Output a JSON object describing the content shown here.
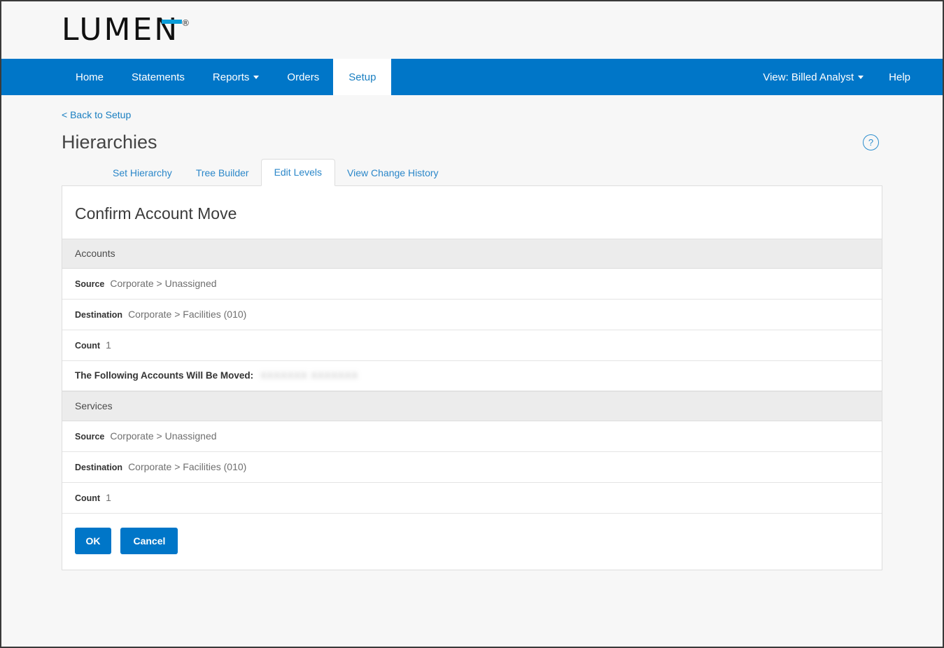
{
  "brand": {
    "logo_text": "LUMEN",
    "registered_mark": "®"
  },
  "nav": {
    "items": [
      {
        "label": "Home",
        "active": false,
        "caret": false
      },
      {
        "label": "Statements",
        "active": false,
        "caret": false
      },
      {
        "label": "Reports",
        "active": false,
        "caret": true
      },
      {
        "label": "Orders",
        "active": false,
        "caret": false
      },
      {
        "label": "Setup",
        "active": true,
        "caret": false
      }
    ],
    "view_selector": "View: Billed Analyst",
    "help": "Help"
  },
  "page": {
    "back_link": "< Back to Setup",
    "title": "Hierarchies",
    "help_icon": "?"
  },
  "tabs": [
    {
      "label": "Set Hierarchy",
      "active": false
    },
    {
      "label": "Tree Builder",
      "active": false
    },
    {
      "label": "Edit Levels",
      "active": true
    },
    {
      "label": "View Change History",
      "active": false
    }
  ],
  "card": {
    "title": "Confirm Account Move",
    "accounts": {
      "heading": "Accounts",
      "source_label": "Source",
      "source_value": "Corporate > Unassigned",
      "destination_label": "Destination",
      "destination_value": "Corporate > Facilities (010)",
      "count_label": "Count",
      "count_value": "1",
      "moved_label": "The Following Accounts Will Be Moved:",
      "moved_value": "XXXXXXX XXXXXXX"
    },
    "services": {
      "heading": "Services",
      "source_label": "Source",
      "source_value": "Corporate > Unassigned",
      "destination_label": "Destination",
      "destination_value": "Corporate > Facilities (010)",
      "count_label": "Count",
      "count_value": "1"
    },
    "ok_label": "OK",
    "cancel_label": "Cancel"
  },
  "colors": {
    "brand_blue": "#0076c8",
    "logo_accent": "#0b9dd9",
    "link_blue": "#1a7fc1",
    "section_gray": "#ececec",
    "page_background": "#f7f7f7"
  }
}
